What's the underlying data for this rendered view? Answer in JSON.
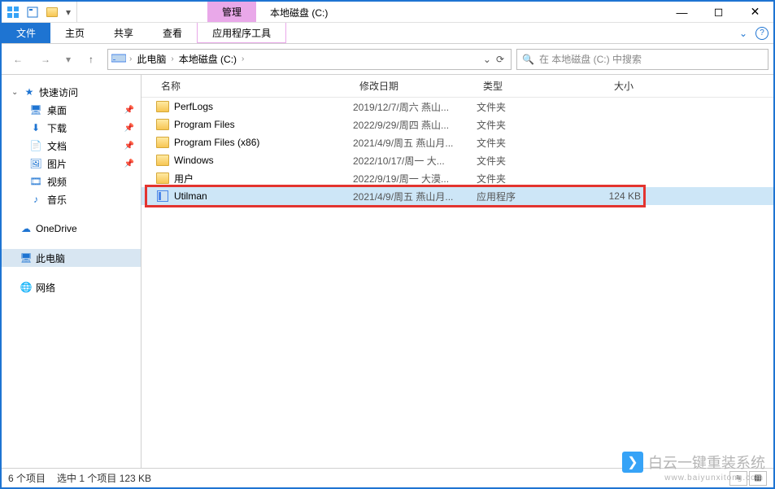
{
  "title": "本地磁盘 (C:)",
  "contextual_tab_group": "管理",
  "ribbon": {
    "file": "文件",
    "tabs": [
      "主页",
      "共享",
      "查看"
    ],
    "ctx_tab": "应用程序工具"
  },
  "nav": {
    "breadcrumb": [
      {
        "icon": "pc",
        "label": "此电脑"
      },
      {
        "icon": "",
        "label": "本地磁盘 (C:)"
      }
    ],
    "search_placeholder": "在 本地磁盘 (C:) 中搜索"
  },
  "sidebar": {
    "quick": {
      "label": "快速访问",
      "items": [
        {
          "icon": "desktop",
          "label": "桌面",
          "pinned": true
        },
        {
          "icon": "download",
          "label": "下载",
          "pinned": true
        },
        {
          "icon": "doc",
          "label": "文档",
          "pinned": true
        },
        {
          "icon": "pic",
          "label": "图片",
          "pinned": true
        },
        {
          "icon": "vid",
          "label": "视频",
          "pinned": false
        },
        {
          "icon": "music",
          "label": "音乐",
          "pinned": false
        }
      ]
    },
    "onedrive": {
      "label": "OneDrive"
    },
    "thispc": {
      "label": "此电脑",
      "selected": true
    },
    "network": {
      "label": "网络"
    }
  },
  "columns": {
    "name": "名称",
    "date": "修改日期",
    "type": "类型",
    "size": "大小"
  },
  "rows": [
    {
      "icon": "folder",
      "name": "PerfLogs",
      "date": "2019/12/7/周六 燕山...",
      "type": "文件夹",
      "size": ""
    },
    {
      "icon": "folder",
      "name": "Program Files",
      "date": "2022/9/29/周四 燕山...",
      "type": "文件夹",
      "size": ""
    },
    {
      "icon": "folder",
      "name": "Program Files (x86)",
      "date": "2021/4/9/周五 燕山月...",
      "type": "文件夹",
      "size": ""
    },
    {
      "icon": "folder",
      "name": "Windows",
      "date": "2022/10/17/周一 大...",
      "type": "文件夹",
      "size": ""
    },
    {
      "icon": "folder",
      "name": "用户",
      "date": "2022/9/19/周一 大漠...",
      "type": "文件夹",
      "size": ""
    },
    {
      "icon": "app",
      "name": "Utilman",
      "date": "2021/4/9/周五 燕山月...",
      "type": "应用程序",
      "size": "124 KB",
      "selected": true
    }
  ],
  "status": {
    "items": "6 个项目",
    "selection": "选中 1 个项目  123 KB"
  },
  "watermark": {
    "brand": "白云一键重装系统",
    "url": "www.baiyunxitong.com"
  }
}
